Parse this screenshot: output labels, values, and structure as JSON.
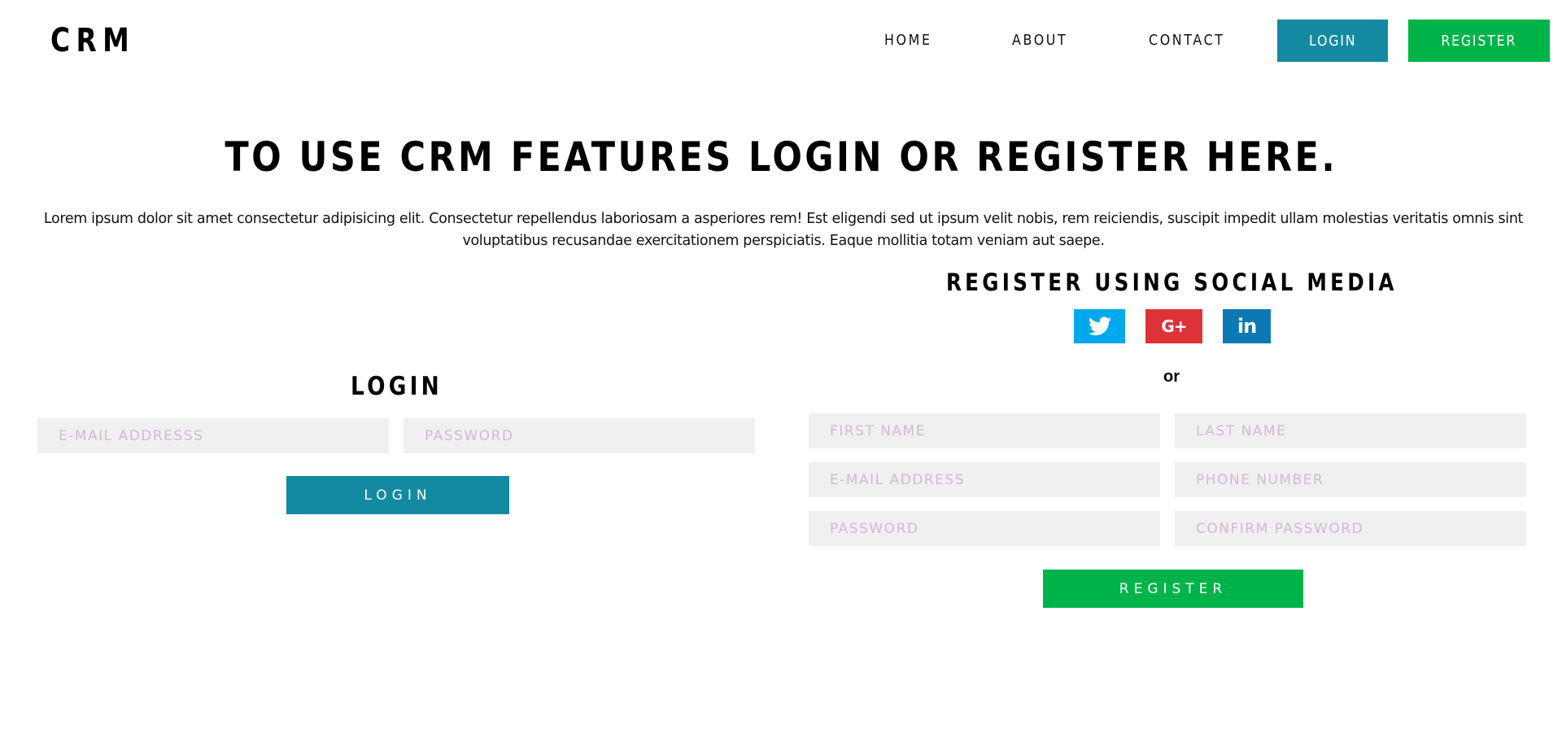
{
  "header": {
    "logo": "CRM",
    "nav": {
      "home": "HOME",
      "about": "ABOUT",
      "contact": "CONTACT",
      "login": "LOGIN",
      "register": "REGISTER"
    }
  },
  "hero": {
    "title": "TO USE CRM FEATURES LOGIN OR REGISTER HERE.",
    "text": "Lorem ipsum dolor sit amet consectetur adipisicing elit. Consectetur repellendus laboriosam a asperiores rem! Est eligendi sed ut ipsum velit nobis, rem reiciendis, suscipit impedit ullam molestias veritatis omnis sint voluptatibus recusandae exercitationem perspiciatis. Eaque mollitia totam veniam aut saepe."
  },
  "login": {
    "title": "LOGIN",
    "email_placeholder": "E-MAIL ADDRESSS",
    "password_placeholder": "PASSWORD",
    "submit_label": "LOGIN"
  },
  "register": {
    "social_title": "REGISTER USING SOCIAL MEDIA",
    "social_icons": [
      "twitter-icon",
      "google-plus-icon",
      "linkedin-icon"
    ],
    "gplus_glyph": "G+",
    "linkedin_glyph": "in",
    "or_text": "or",
    "first_name_placeholder": "FIRST NAME",
    "last_name_placeholder": "LAST NAME",
    "email_placeholder": "E-MAIL ADDRESS",
    "phone_placeholder": "PHONE NUMBER",
    "password_placeholder": "PASSWORD",
    "confirm_password_placeholder": "CONFIRM PASSWORD",
    "submit_label": "REGISTER"
  },
  "colors": {
    "login_blue": "#138aa2",
    "register_green": "#00b44a",
    "twitter": "#00a9ec",
    "google_plus": "#dd3238",
    "linkedin": "#0b79b3",
    "field_background": "#f0f0f0",
    "placeholder": "#d3b7d7"
  }
}
